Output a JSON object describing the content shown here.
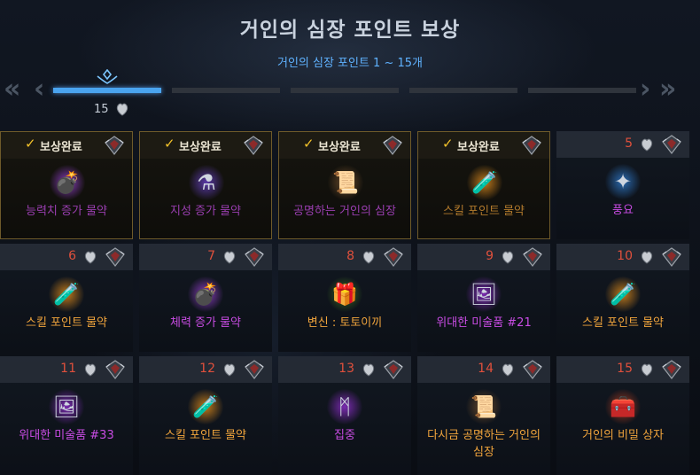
{
  "header": {
    "title": "거인의 심장 포인트 보상",
    "subtitle": "거인의 심장 포인트 1 ~ 15개",
    "current_points": "15"
  },
  "nav": {
    "prev_far": "«",
    "prev": "‹",
    "next": "›",
    "next_far": "»"
  },
  "rewards": [
    {
      "status": "보상완료",
      "check": "✓",
      "name": "능력치 증가 물약",
      "icon": "potion-bomb",
      "color": "purple"
    },
    {
      "status": "보상완료",
      "check": "✓",
      "name": "지성 증가 물약",
      "icon": "potion-flask",
      "color": "purple"
    },
    {
      "status": "보상완료",
      "check": "✓",
      "name": "공명하는 거인의 심장",
      "icon": "scroll",
      "color": "purple"
    },
    {
      "status": "보상완료",
      "check": "✓",
      "name": "스킬 포인트 물약",
      "icon": "potion-blue",
      "color": "orange"
    },
    {
      "num": "5",
      "name": "풍요",
      "icon": "rune-blue",
      "color": "purple"
    },
    {
      "num": "6",
      "name": "스킬 포인트 물약",
      "icon": "potion-blue",
      "color": "orange"
    },
    {
      "num": "7",
      "name": "체력 증가 물약",
      "icon": "potion-bomb",
      "color": "purple"
    },
    {
      "num": "8",
      "name": "변신 : 토토이끼",
      "icon": "chest-green",
      "color": "orange"
    },
    {
      "num": "9",
      "name": "위대한 미술품 #21",
      "icon": "painting",
      "color": "purple"
    },
    {
      "num": "10",
      "name": "스킬 포인트 물약",
      "icon": "potion-blue",
      "color": "orange"
    },
    {
      "num": "11",
      "name": "위대한 미술품 #33",
      "icon": "painting",
      "color": "purple"
    },
    {
      "num": "12",
      "name": "스킬 포인트 물약",
      "icon": "potion-blue",
      "color": "orange"
    },
    {
      "num": "13",
      "name": "집중",
      "icon": "rune-purple",
      "color": "purple"
    },
    {
      "num": "14",
      "name": "다시금 공명하는 거인의 심장",
      "icon": "scroll",
      "color": "orange"
    },
    {
      "num": "15",
      "name": "거인의 비밀 상자",
      "icon": "chest-red",
      "color": "orange"
    }
  ],
  "colors": {
    "accent_blue": "#4aa4ef",
    "reward_orange": "#f0a43c",
    "reward_purple": "#c94ce4",
    "number_red": "#e0503c",
    "check_gold": "#f3c22a"
  }
}
